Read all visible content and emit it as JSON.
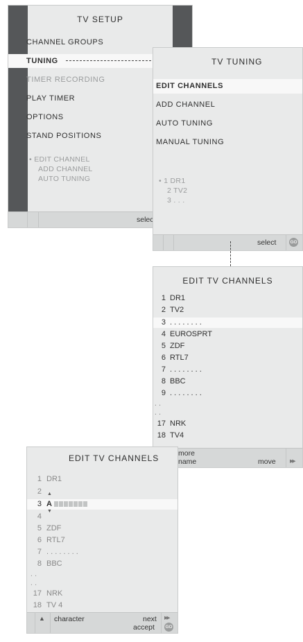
{
  "tv_setup": {
    "title": "TV SETUP",
    "items": [
      "CHANNEL GROUPS",
      "TUNING",
      "TIMER RECORDING",
      "PLAY TIMER",
      "OPTIONS",
      "STAND POSITIONS"
    ],
    "submenu": [
      "• EDIT CHANNEL",
      "ADD CHANNEL",
      "AUTO TUNING"
    ],
    "select_label": "select"
  },
  "tv_tuning": {
    "title": "TV TUNING",
    "items": [
      "EDIT CHANNELS",
      "ADD CHANNEL",
      "AUTO TUNING",
      "MANUAL TUNING"
    ],
    "preview": [
      "• 1 DR1",
      "2 TV2",
      "3 . . ."
    ],
    "select_label": "select",
    "go_icon": "GO"
  },
  "edit_channels": {
    "title": "EDIT TV CHANNELS",
    "channels": [
      {
        "num": "1",
        "name": "DR1"
      },
      {
        "num": "2",
        "name": "TV2"
      },
      {
        "num": "3",
        "name": ". . . . . . . ."
      },
      {
        "num": "4",
        "name": "EUROSPRT"
      },
      {
        "num": "5",
        "name": "ZDF"
      },
      {
        "num": "6",
        "name": "RTL7"
      },
      {
        "num": "7",
        "name": ". . . . . . . ."
      },
      {
        "num": "8",
        "name": "BBC"
      },
      {
        "num": "9",
        "name": ". . . . . . . ."
      },
      {
        "num": ". .",
        "name": ""
      },
      {
        "num": ". .",
        "name": ""
      },
      {
        "num": "17",
        "name": "NRK"
      },
      {
        "num": "18",
        "name": "TV4"
      }
    ],
    "bar": {
      "more": "more",
      "name": "name",
      "move": "move",
      "arrow": "▼",
      "ff": "▸▸"
    }
  },
  "edit_name": {
    "title": "EDIT TV CHANNELS",
    "channels": [
      {
        "num": "1",
        "name": "DR1"
      },
      {
        "num": "2",
        "name": ""
      },
      {
        "num": "3",
        "name": "A"
      },
      {
        "num": "4",
        "name": ""
      },
      {
        "num": "5",
        "name": "ZDF"
      },
      {
        "num": "6",
        "name": "RTL7"
      },
      {
        "num": "7",
        "name": ". . . . . . . ."
      },
      {
        "num": "8",
        "name": "BBC"
      },
      {
        "num": ". .",
        "name": ""
      },
      {
        "num": ". .",
        "name": ""
      },
      {
        "num": "17",
        "name": "NRK"
      },
      {
        "num": "18",
        "name": "TV 4"
      }
    ],
    "up_arrow": "▲",
    "down_arrow": "▼",
    "bar": {
      "arrow": "▲",
      "character": "character",
      "next": "next",
      "accept": "accept",
      "ff": "▸▸",
      "go": "GO"
    }
  },
  "colors": {
    "panel": "#e9eaea",
    "highlight": "#f8f8f8",
    "sidebar": "#555759",
    "bar": "#d6d8d8",
    "green": "#3aa640"
  }
}
